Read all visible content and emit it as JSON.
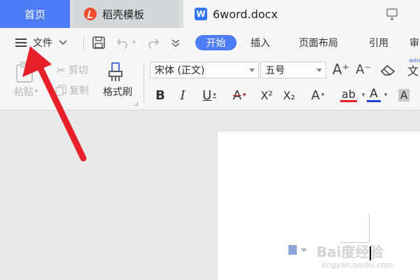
{
  "tabs": {
    "home": "首页",
    "daoke": "稻壳模板",
    "doc_icon_letter": "W",
    "doc": "6word.docx"
  },
  "menubar": {
    "file": "文件",
    "start": "开始",
    "insert": "插入",
    "layout": "页面布局",
    "reference": "引用",
    "partial": "审"
  },
  "ribbon": {
    "paste": "粘贴",
    "cut": "剪切",
    "copy": "复制",
    "format_painter": "格式刷",
    "font_name": "宋体 (正文)",
    "font_size": "五号",
    "bold": "B",
    "italic": "I",
    "underline": "U",
    "strike": "A",
    "superscript": "X²",
    "subscript": "X₂",
    "text_effect": "A",
    "highlight": "ab",
    "font_color": "A",
    "char_shade": "A",
    "grow": "A⁺",
    "shrink": "A⁻",
    "partial_char": "文",
    "pinyin": "wén"
  },
  "watermark": {
    "brand": "Bai度经验",
    "url": "jingyan.baidu.com"
  },
  "colors": {
    "accent": "#4f7df9",
    "arrow": "#e8202a",
    "highlight_bar": "#e8202a",
    "font_color_bar": "#2540d9"
  }
}
